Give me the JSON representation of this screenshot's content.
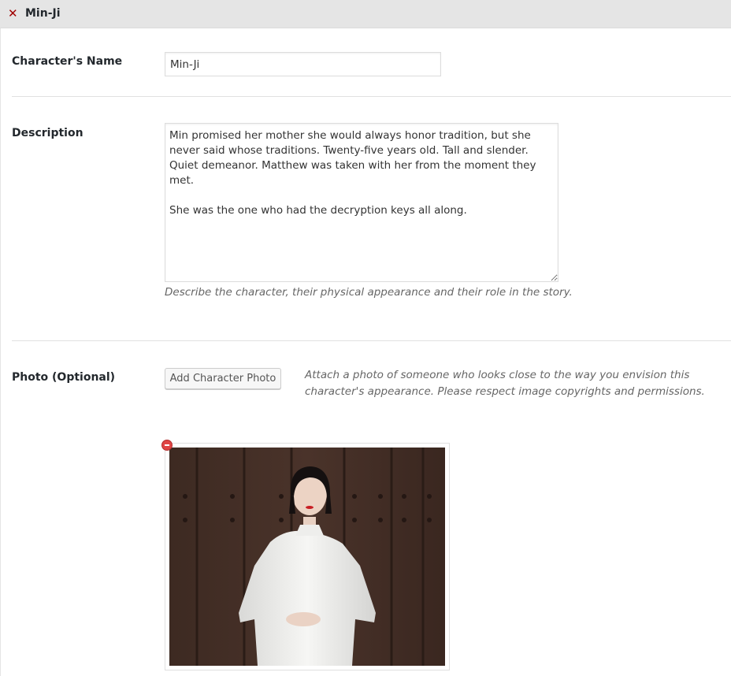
{
  "header": {
    "close_icon": "close-icon",
    "title": "Min-Ji"
  },
  "name_field": {
    "label": "Character's Name",
    "value": "Min-Ji"
  },
  "description_field": {
    "label": "Description",
    "value": "Min promised her mother she would always honor tradition, but she never said whose traditions. Twenty-five years old. Tall and slender. Quiet demeanor. Matthew was taken with her from the moment they met.\n\nShe was the one who had the decryption keys all along.",
    "hint": "Describe the character, their physical appearance and their role in the story."
  },
  "photo_field": {
    "label": "Photo (Optional)",
    "button_label": "Add Character Photo",
    "hint": "Attach a photo of someone who looks close to the way you envision this character's appearance. Please respect image copyrights and permissions.",
    "remove_icon": "remove-icon"
  },
  "colors": {
    "header_bg": "#e5e5e5",
    "close_red": "#a00000",
    "remove_red": "#e04646"
  }
}
